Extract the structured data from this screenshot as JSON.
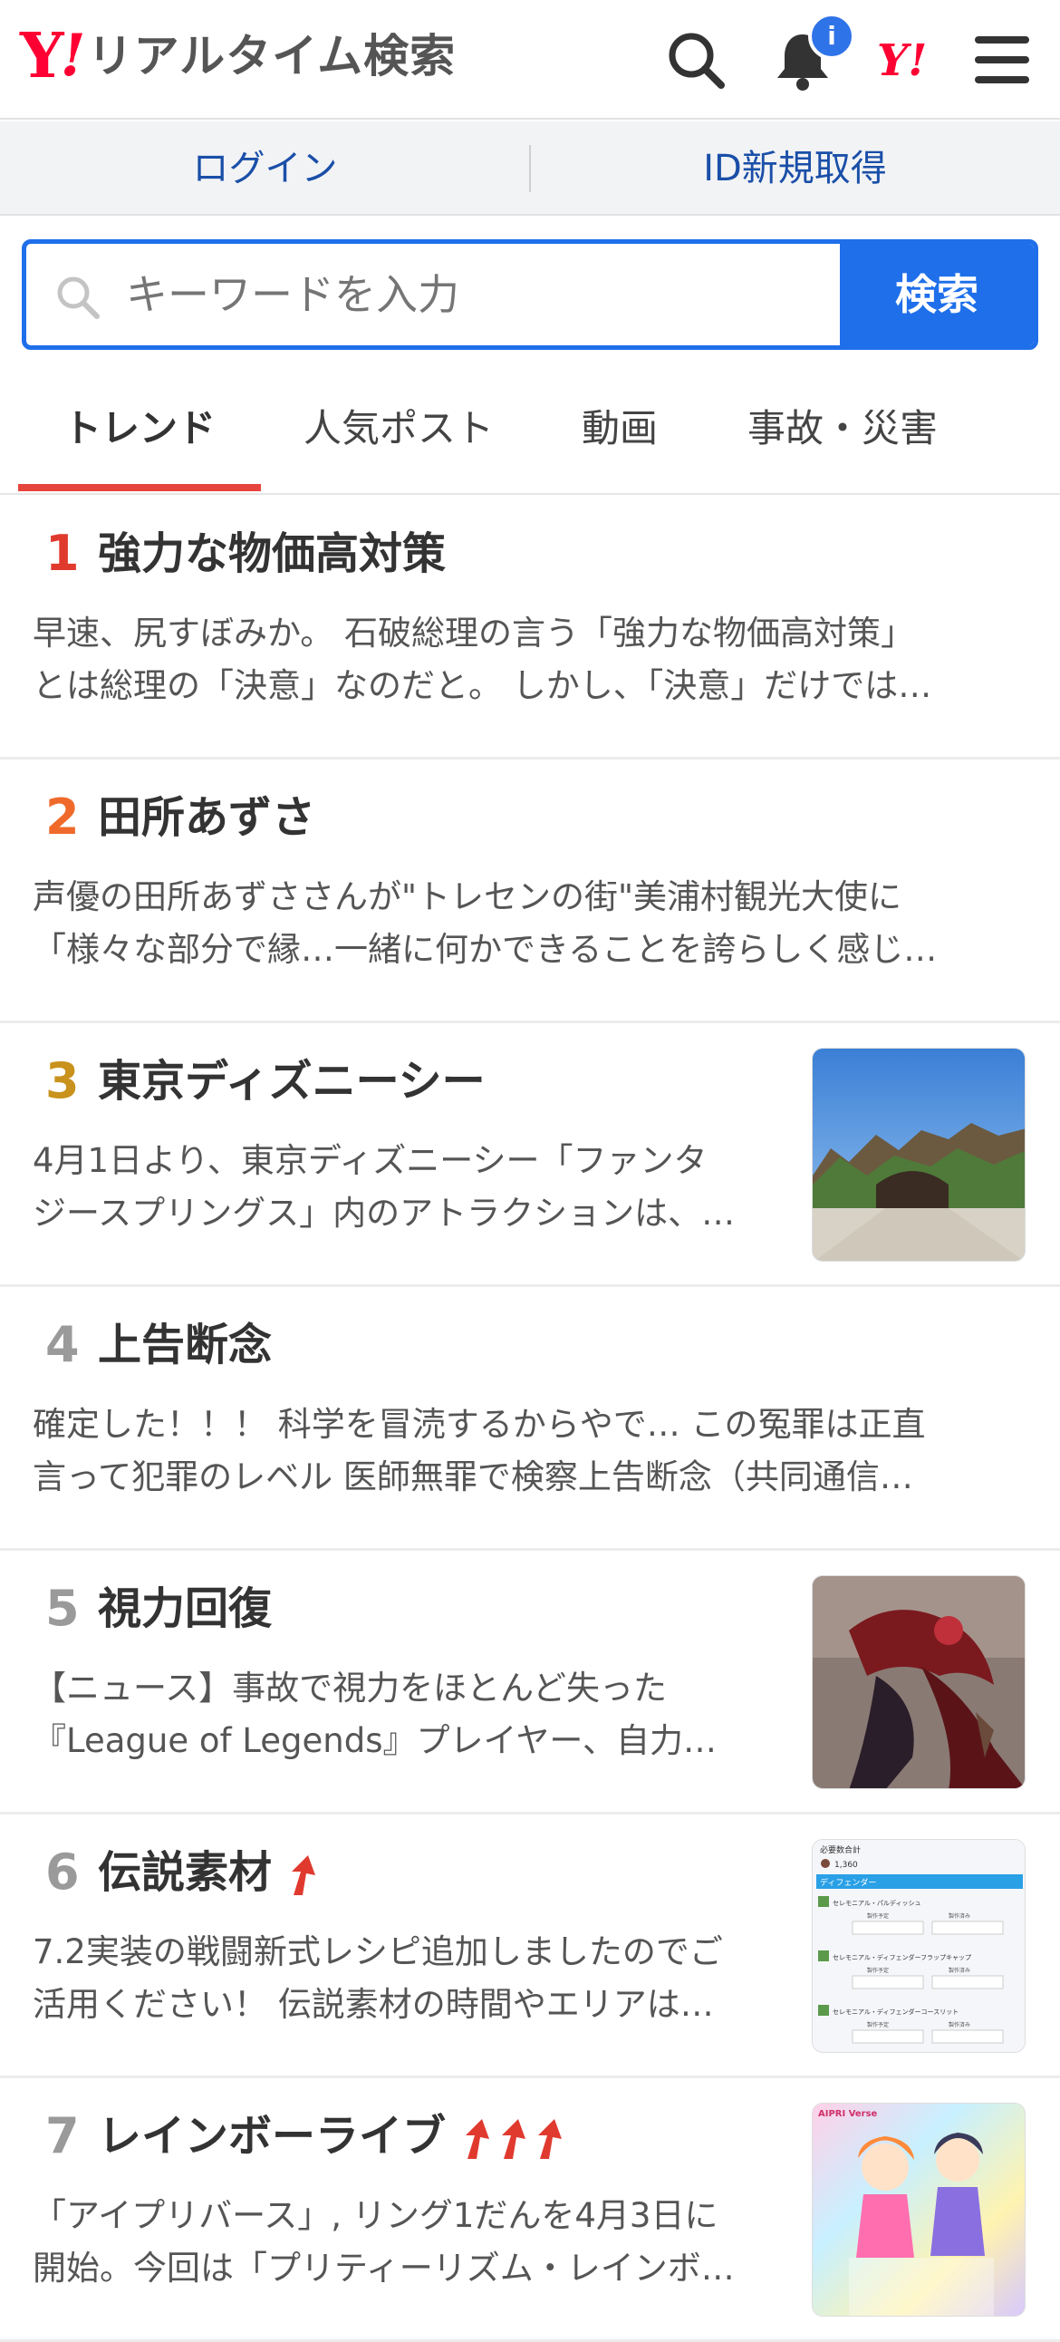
{
  "header": {
    "logo_y": "Y",
    "logo_ex": "!",
    "logo_text": "リアルタイム検索",
    "brand_mark": "Y!",
    "notification_badge": "i",
    "icons": [
      "search-icon",
      "bell-icon",
      "menu-icon"
    ],
    "accent_color": "#ff0033"
  },
  "auth": {
    "login": "ログイン",
    "register": "ID新規取得"
  },
  "search": {
    "placeholder": "キーワードを入力",
    "button": "検索",
    "color": "#1f6fea"
  },
  "tabs": [
    {
      "label": "トレンド",
      "active": true
    },
    {
      "label": "人気ポスト",
      "active": false
    },
    {
      "label": "動画",
      "active": false
    },
    {
      "label": "事故・災害",
      "active": false
    }
  ],
  "trends": [
    {
      "rank": "1",
      "rank_color": "#e03a2f",
      "title": "強力な物価高対策",
      "rising": 0,
      "has_thumb": false,
      "desc": [
        "早速、尻すぼみか。 石破総理の言う「強力な物価高対策」",
        "とは総理の「決意」なのだと。 しかし、「決意」だけでは…"
      ]
    },
    {
      "rank": "2",
      "rank_color": "#ef6a2a",
      "title": "田所あずさ",
      "rising": 0,
      "has_thumb": false,
      "desc": [
        "声優の田所あずささんが\"トレセンの街\"美浦村観光大使に",
        "「様々な部分で縁…一緒に何かできることを誇らしく感じ…"
      ]
    },
    {
      "rank": "3",
      "rank_color": "#c8921c",
      "title": "東京ディズニーシー",
      "rising": 0,
      "has_thumb": true,
      "thumb": "disney-sea-photo",
      "desc": [
        "4月1日より、東京ディズニーシー「ファンタ",
        "ジースプリングス」内のアトラクションは、…"
      ]
    },
    {
      "rank": "4",
      "rank_color": "#9a9a9a",
      "title": "上告断念",
      "rising": 0,
      "has_thumb": false,
      "desc": [
        "確定した！！！ 科学を冒涜するからやで… この冤罪は正直",
        "言って犯罪のレベル 医師無罪で検察上告断念（共同通信…"
      ]
    },
    {
      "rank": "5",
      "rank_color": "#9a9a9a",
      "title": "視力回復",
      "rising": 0,
      "has_thumb": true,
      "thumb": "game-art-image",
      "desc": [
        "【ニュース】事故で視力をほとんど失った",
        "『League of Legends』プレイヤー、自力…"
      ]
    },
    {
      "rank": "6",
      "rank_color": "#9a9a9a",
      "title": "伝説素材",
      "rising": 1,
      "has_thumb": true,
      "thumb": "game-ui-screenshot",
      "desc": [
        "7.2実装の戦闘新式レシピ追加しましたのでご",
        "活用ください！ 伝説素材の時間やエリアは…"
      ]
    },
    {
      "rank": "7",
      "rank_color": "#9a9a9a",
      "title": "レインボーライブ",
      "rising": 3,
      "has_thumb": true,
      "thumb": "anime-illustration",
      "desc": [
        "「アイプリバース」, リング1だんを4月3日に",
        "開始。今回は「プリティーリズム・レインボ…"
      ]
    }
  ],
  "thumb_labels": {
    "game_ui_header": "必要数合計",
    "game_ui_count": "1,360",
    "game_ui_category": "ディフェンダー",
    "game_ui_rows": [
      "セレモニアル・パルディッシュ",
      "セレモニアル・ディフェンダーフラップキャップ",
      "セレモニアル・ディフェンダーコースリット"
    ],
    "game_ui_col_a": "製作予定",
    "game_ui_col_b": "製作済み",
    "anime_brand": "AIPRI Verse"
  }
}
